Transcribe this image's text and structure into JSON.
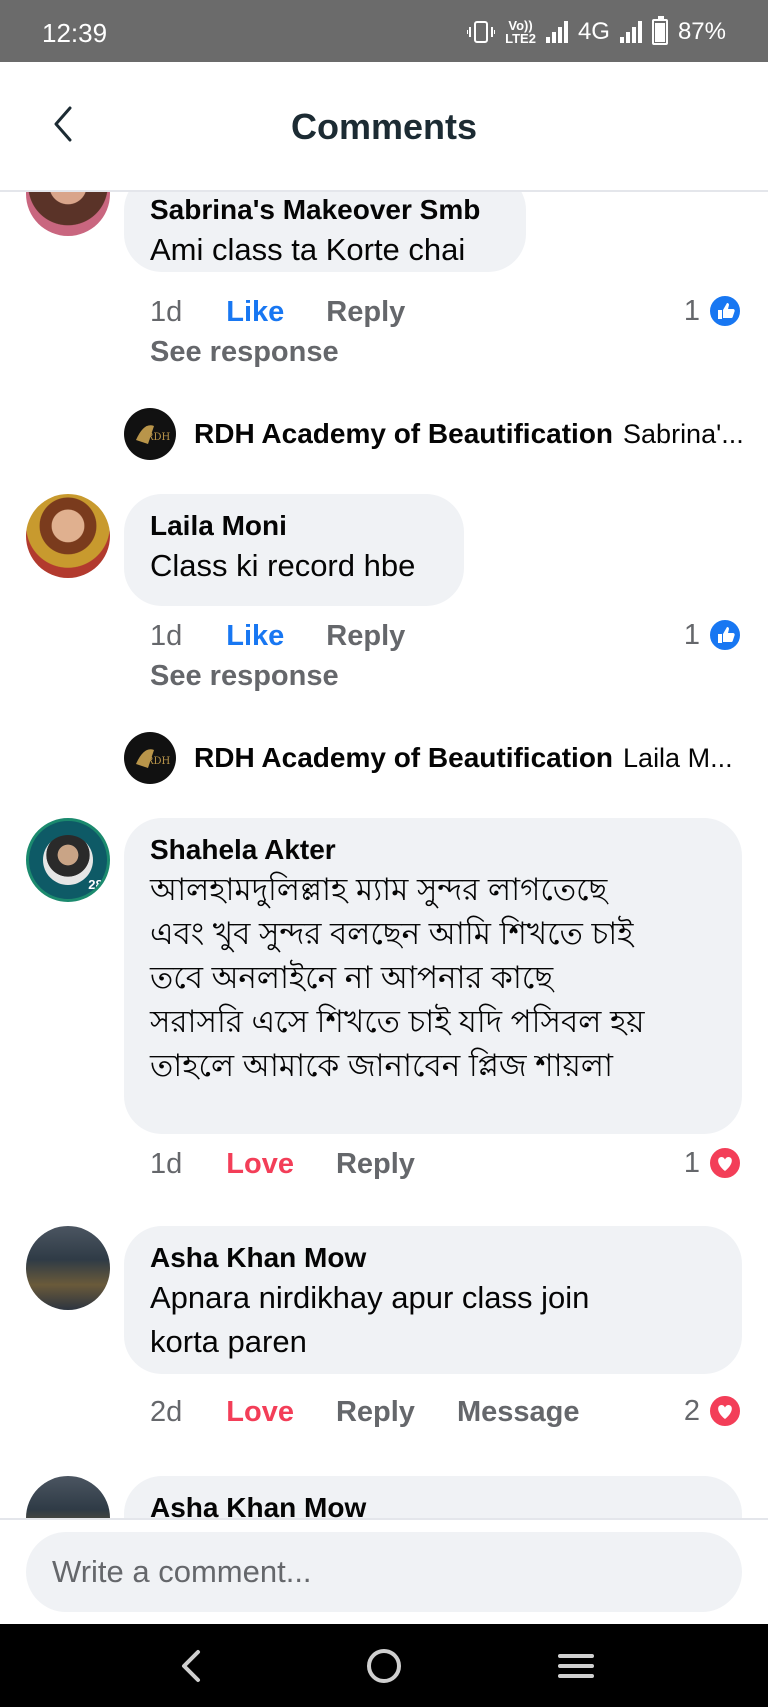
{
  "status": {
    "time": "12:39",
    "volte_top": "Vo))",
    "volte_bottom": "LTE2",
    "network": "4G",
    "battery": "87%"
  },
  "header": {
    "title": "Comments"
  },
  "comments": [
    {
      "author": "Sabrina's Makeover Smb",
      "text": "Ami class ta Korte chai",
      "time": "1d",
      "reaction_label": "Like",
      "reply_label": "Reply",
      "reaction_count": "1",
      "see_response": "See response",
      "reply_author": "RDH Academy of Beautification",
      "reply_snippet": "Sabrina'..."
    },
    {
      "author": "Laila Moni",
      "text": "Class ki record hbe",
      "time": "1d",
      "reaction_label": "Like",
      "reply_label": "Reply",
      "reaction_count": "1",
      "see_response": "See response",
      "reply_author": "RDH Academy of Beautification",
      "reply_snippet": "Laila M..."
    },
    {
      "author": "Shahela Akter",
      "badge": "285",
      "text_lines": [
        "আলহামদুলিল্লাহ ম্যাম সুন্দর লাগতেছে",
        "এবং খুব সুন্দর বলছেন আমি শিখতে চাই",
        "তবে অনলাইনে না  আপনার কাছে",
        "সরাসরি এসে শিখতে চাই  যদি পসিবল হয়",
        "তাহলে  আমাকে জানাবেন প্লিজ শায়লা"
      ],
      "time": "1d",
      "reaction_label": "Love",
      "reply_label": "Reply",
      "reaction_count": "1"
    },
    {
      "author": "Asha Khan Mow",
      "text_lines": [
        "Apnara nirdikhay apur class join",
        "korta paren"
      ],
      "time": "2d",
      "reaction_label": "Love",
      "reply_label": "Reply",
      "message_label": "Message",
      "reaction_count": "2"
    },
    {
      "author": "Asha Khan Mow"
    }
  ],
  "composer": {
    "placeholder": "Write a comment..."
  },
  "icons": {
    "back": "back-arrow-icon",
    "like": "thumbs-up-icon",
    "love": "heart-icon",
    "nav_back": "nav-back-icon",
    "nav_home": "nav-home-icon",
    "nav_recents": "nav-recents-icon"
  },
  "colors": {
    "like_blue": "#1877f2",
    "love_red": "#f33e58",
    "bubble_bg": "#f0f2f5",
    "muted_text": "#65676b"
  }
}
